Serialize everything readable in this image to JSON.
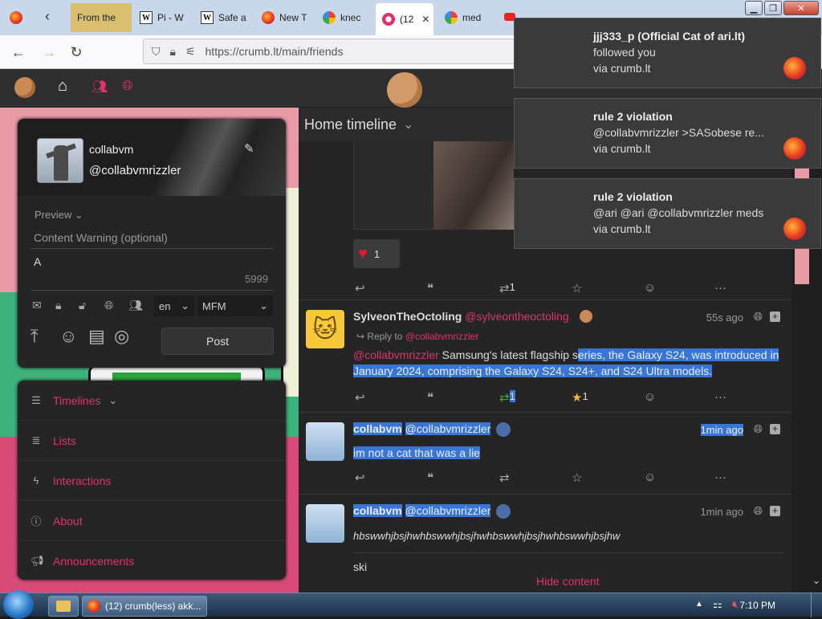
{
  "browser": {
    "tabs": [
      {
        "label": "From the",
        "icon": "page-thumbnail-icon"
      },
      {
        "label": "Pi - W",
        "icon": "wikipedia-icon"
      },
      {
        "label": "Safe a",
        "icon": "wikipedia-icon"
      },
      {
        "label": "New T",
        "icon": "firefox-icon"
      },
      {
        "label": "knec",
        "icon": "google-icon"
      },
      {
        "label": "(12",
        "icon": "crumb-icon"
      },
      {
        "label": "med",
        "icon": "google-icon"
      }
    ],
    "url": "https://crumb.lt/main/friends"
  },
  "form": {
    "display_name": "collabvm",
    "handle": "@collabvmrizzler",
    "preview_label": "Preview",
    "cw_placeholder": "Content Warning (optional)",
    "text_value": "A",
    "char_count": "5999",
    "lang": "en",
    "format": "MFM",
    "post_label": "Post"
  },
  "nav": {
    "items": [
      {
        "label": "Timelines",
        "icon": "bars-icon"
      },
      {
        "label": "Lists",
        "icon": "list-icon"
      },
      {
        "label": "Interactions",
        "icon": "bolt-icon"
      },
      {
        "label": "About",
        "icon": "info-icon"
      },
      {
        "label": "Announcements",
        "icon": "megaphone-icon"
      }
    ]
  },
  "timeline": {
    "title": "Home timeline",
    "posts": [
      {
        "reactions": "1",
        "boosts": "1"
      },
      {
        "user": "SylveonTheOctoling",
        "handle": "@sylveontheoctoling",
        "time": "55s ago",
        "reply_prefix": "Reply to",
        "reply_to": "@collabvmrizzler",
        "mention": "@collabvmrizzler",
        "text_a": " Samsung's latest flagship s",
        "text_b": "eries, the Galaxy S24, was introduced in January 2024, comprising the Galaxy S24, S24+, and S24 Ultra models.",
        "boosts": "1",
        "favs": "1"
      },
      {
        "user": "collabvm",
        "handle": "@collabvmrizzler",
        "time": "1min ago",
        "text": "im not a cat that was a lie"
      },
      {
        "user": "collabvm",
        "handle": "@collabvmrizzler",
        "time": "1min ago",
        "cw_text": "hbswwhjbsjhwhbswwhjbsjhwhbswwhjbsjhwhbswwhjbsjhw",
        "text": "ski",
        "hide_label": "Hide content"
      }
    ]
  },
  "notifications": [
    {
      "title": "jjj333_p (Official Cat of ari.lt)",
      "body": "followed you",
      "via": "via crumb.lt"
    },
    {
      "title": "rule 2 violation",
      "body": "@collabvmrizzler >SASobese re...",
      "via": "via crumb.lt"
    },
    {
      "title": "rule 2 violation",
      "body": "@ari @ari @collabvmrizzler meds",
      "via": "via crumb.lt"
    }
  ],
  "taskbar": {
    "window_label": "(12) crumb(less) akk...",
    "clock": "7:10 PM"
  },
  "colors": {
    "accent": "#e0326a",
    "selection": "#3875d7"
  }
}
